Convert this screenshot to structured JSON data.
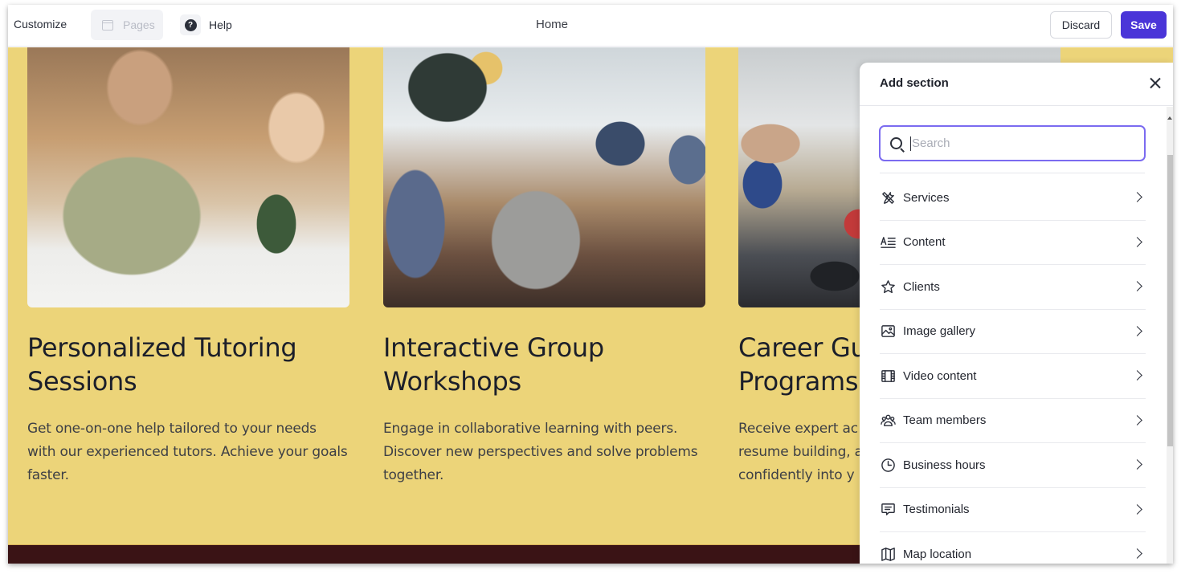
{
  "topbar": {
    "customize_label": "Customize",
    "pages_label": "Pages",
    "help_label": "Help",
    "help_icon_glyph": "?",
    "page_title": "Home",
    "discard_label": "Discard",
    "save_label": "Save"
  },
  "colors": {
    "accent": "#4a35d8",
    "canvas_bg": "#ecd479",
    "footer_band": "#3a1315",
    "search_focus": "#7b6bf0"
  },
  "cards": [
    {
      "photo": "tutor-and-child-reading-photo",
      "title": "Personalized Tutoring Sessions",
      "description": "Get one-on-one help tailored to your needs with our experienced tutors. Achieve your goals faster."
    },
    {
      "photo": "students-group-tablets-photo",
      "title": "Interactive Group Workshops",
      "description": "Engage in collaborative learning with peers. Discover new perspectives and solve problems together."
    },
    {
      "photo": "office-desk-handshake-photo",
      "title": "Career Gu Programs",
      "description": "Receive expert ac resume building, confidently into y"
    }
  ],
  "panel": {
    "title": "Add section",
    "search_placeholder": "Search",
    "search_value": "",
    "items": [
      {
        "label": "Services",
        "icon": "tools-icon"
      },
      {
        "label": "Content",
        "icon": "text-content-icon"
      },
      {
        "label": "Clients",
        "icon": "star-icon"
      },
      {
        "label": "Image gallery",
        "icon": "image-icon"
      },
      {
        "label": "Video content",
        "icon": "film-icon"
      },
      {
        "label": "Team members",
        "icon": "team-icon"
      },
      {
        "label": "Business hours",
        "icon": "clock-icon"
      },
      {
        "label": "Testimonials",
        "icon": "chat-bubble-icon"
      },
      {
        "label": "Map location",
        "icon": "map-icon"
      }
    ]
  }
}
